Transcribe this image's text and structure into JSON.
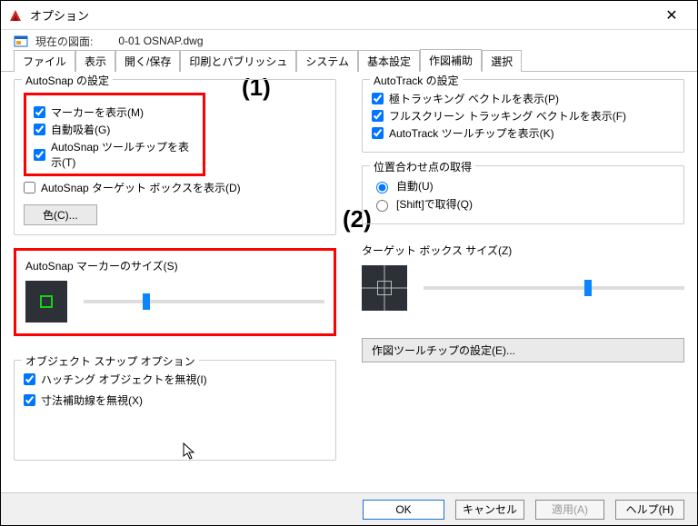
{
  "window": {
    "title": "オプション",
    "close_glyph": "✕"
  },
  "drawing": {
    "label": "現在の図面:",
    "file": "0-01 OSNAP.dwg"
  },
  "tabs": {
    "items": [
      {
        "label": "ファイル"
      },
      {
        "label": "表示"
      },
      {
        "label": "開く/保存"
      },
      {
        "label": "印刷とパブリッシュ"
      },
      {
        "label": "システム"
      },
      {
        "label": "基本設定"
      },
      {
        "label": "作図補助"
      },
      {
        "label": "選択"
      }
    ],
    "active_index": 6
  },
  "annotations": {
    "a1": "(1)",
    "a2": "(2)"
  },
  "left": {
    "autosnap": {
      "legend": "AutoSnap の設定",
      "items": [
        {
          "label": "マーカーを表示(M)",
          "checked": true
        },
        {
          "label": "自動吸着(G)",
          "checked": true
        },
        {
          "label": "AutoSnap ツールチップを表示(T)",
          "checked": true
        }
      ],
      "aperture": {
        "label": "AutoSnap ターゲット ボックスを表示(D)",
        "checked": false
      },
      "color_btn": "色(C)..."
    },
    "marker": {
      "title": "AutoSnap マーカーのサイズ(S)",
      "slider_pct": 26
    },
    "osnap_opts": {
      "legend": "オブジェクト スナップ オプション",
      "items": [
        {
          "label": "ハッチング オブジェクトを無視(I)",
          "checked": true
        },
        {
          "label": "寸法補助線を無視(X)",
          "checked": true
        }
      ]
    }
  },
  "right": {
    "autotrack": {
      "legend": "AutoTrack の設定",
      "items": [
        {
          "label": "極トラッキング ベクトルを表示(P)",
          "checked": true
        },
        {
          "label": "フルスクリーン トラッキング ベクトルを表示(F)",
          "checked": true
        },
        {
          "label": "AutoTrack ツールチップを表示(K)",
          "checked": true
        }
      ]
    },
    "alignpt": {
      "legend": "位置合わせ点の取得",
      "options": [
        {
          "label": "自動(U)",
          "checked": true
        },
        {
          "label": "[Shift]で取得(Q)",
          "checked": false
        }
      ]
    },
    "target": {
      "title": "ターゲット ボックス サイズ(Z)",
      "slider_pct": 63
    },
    "tooltip_btn": "作図ツールチップの設定(E)..."
  },
  "buttons": {
    "ok": "OK",
    "cancel": "キャンセル",
    "apply": "適用(A)",
    "help": "ヘルプ(H)"
  }
}
